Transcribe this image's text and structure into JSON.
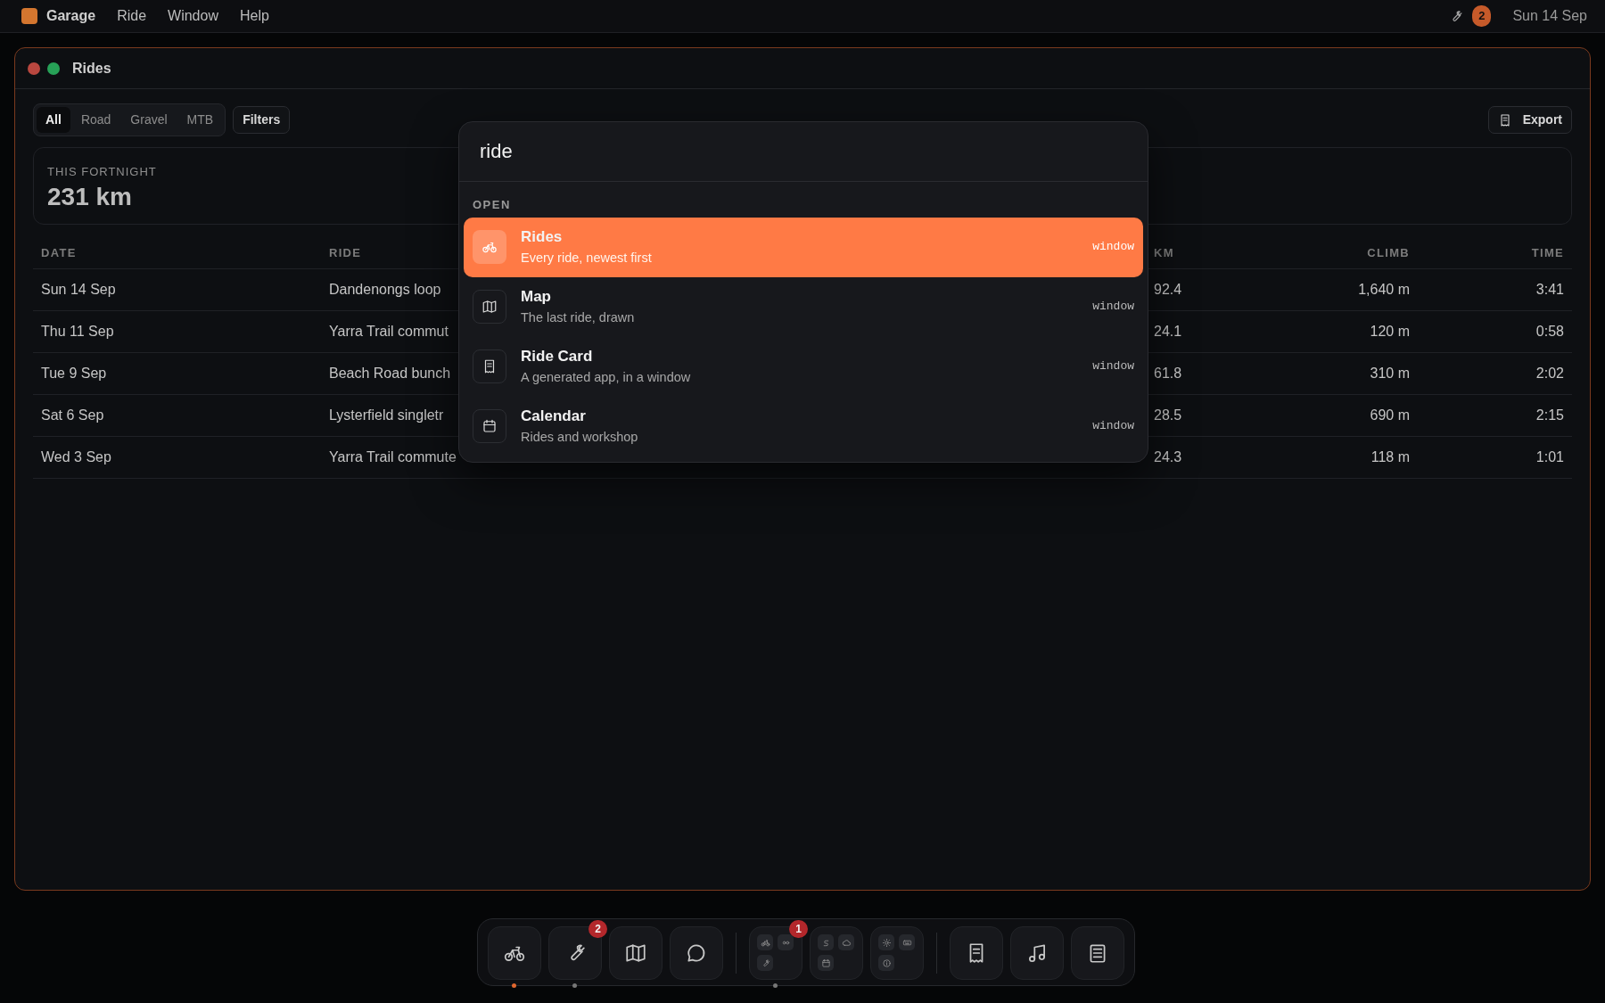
{
  "menu_bar": {
    "app_name": "Garage",
    "menus": [
      "Ride",
      "Window",
      "Help"
    ],
    "badge": "2",
    "date": "Sun 14 Sep"
  },
  "window": {
    "title": "Rides",
    "segments": [
      {
        "label": "All",
        "selected": true
      },
      {
        "label": "Road",
        "selected": false
      },
      {
        "label": "Gravel",
        "selected": false
      },
      {
        "label": "MTB",
        "selected": false
      }
    ],
    "filters_button": "Filters",
    "export_button": "Export",
    "summary": {
      "label": "THIS FORTNIGHT",
      "value": "231 km"
    },
    "table": {
      "columns": [
        "DATE",
        "RIDE",
        "KM",
        "CLIMB",
        "TIME"
      ],
      "rows": [
        [
          "Sun 14 Sep",
          "Dandenongs loop",
          "92.4",
          "1,640 m",
          "3:41"
        ],
        [
          "Thu 11 Sep",
          "Yarra Trail commut",
          "24.1",
          "120 m",
          "0:58"
        ],
        [
          "Tue 9 Sep",
          "Beach Road bunch",
          "61.8",
          "310 m",
          "2:02"
        ],
        [
          "Sat 6 Sep",
          "Lysterfield singletr",
          "28.5",
          "690 m",
          "2:15"
        ],
        [
          "Wed 3 Sep",
          "Yarra Trail commute",
          "24.3",
          "118 m",
          "1:01"
        ]
      ]
    }
  },
  "command_palette": {
    "query": "ride",
    "section": "OPEN",
    "results": [
      {
        "title": "Rides",
        "subtitle": "Every ride, newest first",
        "tag": "window",
        "selected": true
      },
      {
        "title": "Map",
        "subtitle": "The last ride, drawn",
        "tag": "window",
        "selected": false
      },
      {
        "title": "Ride Card",
        "subtitle": "A generated app, in a window",
        "tag": "window",
        "selected": false
      },
      {
        "title": "Calendar",
        "subtitle": "Rides and workshop",
        "tag": "window",
        "selected": false
      }
    ]
  },
  "dock": {
    "items": [
      {
        "kind": "app",
        "open": true,
        "focused": true
      },
      {
        "kind": "app",
        "badge": "2",
        "open": true,
        "focused": false
      },
      {
        "kind": "app",
        "open": false,
        "focused": false
      },
      {
        "kind": "app",
        "open": false,
        "focused": false
      },
      {
        "kind": "separator"
      },
      {
        "kind": "folder",
        "badge": "1",
        "open": true,
        "focused": false
      },
      {
        "kind": "folder",
        "open": false,
        "focused": false
      },
      {
        "kind": "folder",
        "open": false,
        "focused": false
      },
      {
        "kind": "separator"
      },
      {
        "kind": "app",
        "open": false,
        "focused": false
      },
      {
        "kind": "app",
        "open": false,
        "focused": false
      },
      {
        "kind": "app",
        "open": false,
        "focused": false
      }
    ]
  }
}
